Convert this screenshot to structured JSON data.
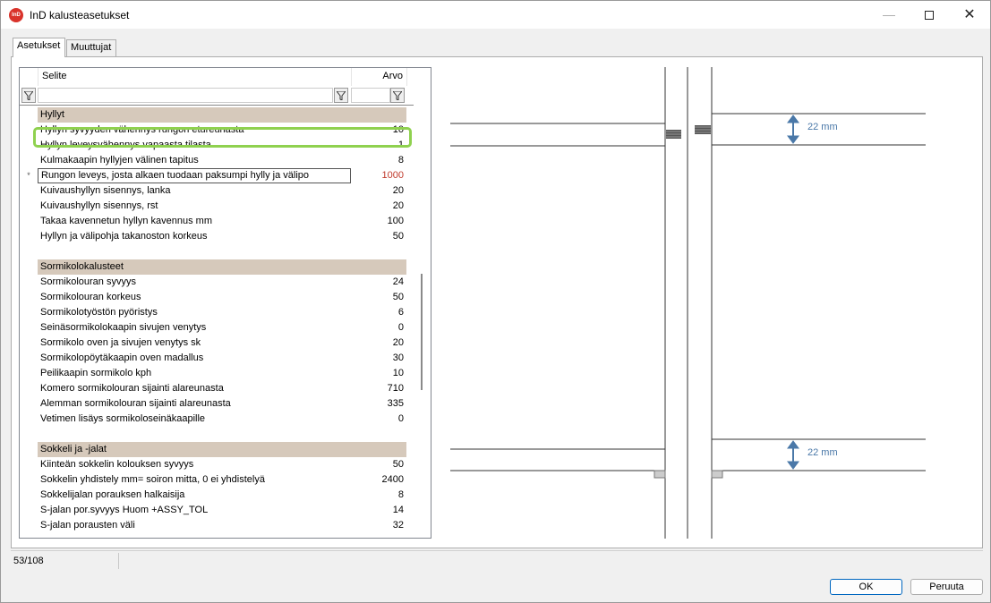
{
  "window": {
    "title": "InD kalusteasetukset",
    "app_icon_text": "InD"
  },
  "tabs": [
    {
      "label": "Asetukset",
      "active": true
    },
    {
      "label": "Muuttujat",
      "active": false
    }
  ],
  "grid": {
    "col_label": "Selite",
    "col_value": "Arvo",
    "rows": [
      {
        "type": "group",
        "label": "Hyllyt",
        "value": ""
      },
      {
        "type": "item",
        "label": "Hyllyn syvyyden vähennys rungon etureunasta",
        "value": "10"
      },
      {
        "type": "item",
        "label": "Hyllyn leveysvähennys vapaasta tilasta",
        "value": "1"
      },
      {
        "type": "item",
        "label": "Kulmakaapin hyllyjen välinen tapitus",
        "value": "8"
      },
      {
        "type": "editing",
        "marker": "*",
        "label": "Rungon leveys, josta alkaen tuodaan paksumpi hylly ja välipo",
        "value": "1000"
      },
      {
        "type": "item",
        "label": "Kuivaushyllyn sisennys, lanka",
        "value": "20"
      },
      {
        "type": "item",
        "label": "Kuivaushyllyn sisennys, rst",
        "value": "20"
      },
      {
        "type": "item",
        "label": "Takaa kavennetun hyllyn kavennus mm",
        "value": "100"
      },
      {
        "type": "item",
        "label": "Hyllyn ja välipohja takanoston korkeus",
        "value": "50"
      },
      {
        "type": "spacer",
        "label": "",
        "value": ""
      },
      {
        "type": "group",
        "label": "Sormikolokalusteet",
        "value": ""
      },
      {
        "type": "item",
        "label": "Sormikolouran syvyys",
        "value": "24"
      },
      {
        "type": "item",
        "label": "Sormikolouran korkeus",
        "value": "50"
      },
      {
        "type": "item",
        "label": "Sormikolotyöstön pyöristys",
        "value": "6"
      },
      {
        "type": "item",
        "label": "Seinäsormikolokaapin sivujen venytys",
        "value": "0"
      },
      {
        "type": "item",
        "label": "Sormikolo oven ja sivujen venytys sk",
        "value": "20"
      },
      {
        "type": "item",
        "label": "Sormikolopöytäkaapin oven madallus",
        "value": "30"
      },
      {
        "type": "item",
        "label": "Peilikaapin sormikolo kph",
        "value": "10"
      },
      {
        "type": "item",
        "label": "Komero sormikolouran sijainti alareunasta",
        "value": "710"
      },
      {
        "type": "item",
        "label": "Alemman sormikolouran sijainti alareunasta",
        "value": "335"
      },
      {
        "type": "item",
        "label": "Vetimen lisäys sormikoloseinäkaapille",
        "value": "0"
      },
      {
        "type": "spacer",
        "label": "",
        "value": ""
      },
      {
        "type": "group",
        "label": "Sokkeli ja -jalat",
        "value": ""
      },
      {
        "type": "item",
        "label": "Kiinteän sokkelin kolouksen syvyys",
        "value": "50"
      },
      {
        "type": "item",
        "label": "Sokkelin yhdistely mm= soiron mitta, 0 ei yhdistelyä",
        "value": "2400"
      },
      {
        "type": "item",
        "label": "Sokkelijalan porauksen halkaisija",
        "value": "8"
      },
      {
        "type": "item",
        "label": "S-jalan por.syvyys Huom +ASSY_TOL",
        "value": "14"
      },
      {
        "type": "item",
        "label": "S-jalan porausten väli",
        "value": "32"
      }
    ]
  },
  "preview": {
    "dim_top": "22 mm",
    "dim_bottom": "22 mm",
    "dim_color": "#4a78a8"
  },
  "status": {
    "count": "53/108"
  },
  "buttons": {
    "ok": "OK",
    "cancel": "Peruuta"
  }
}
